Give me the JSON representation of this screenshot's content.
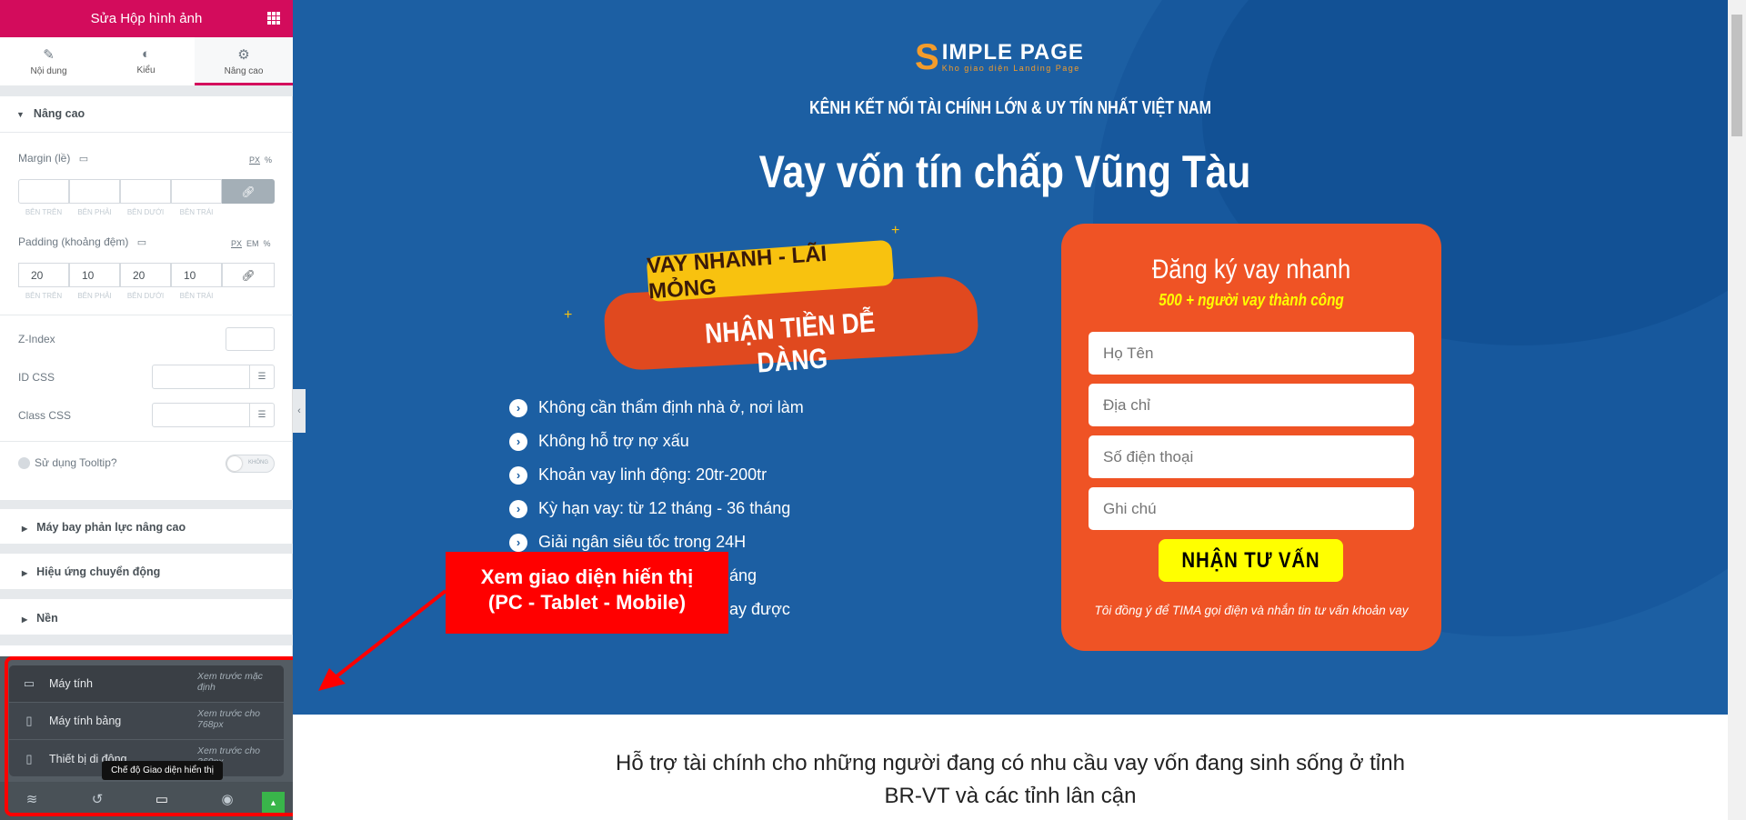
{
  "sidebar": {
    "title": "Sửa Hộp hình ảnh",
    "tabs": [
      {
        "label": "Nội dung",
        "icon": "pencil-icon"
      },
      {
        "label": "Kiểu",
        "icon": "contrast-icon"
      },
      {
        "label": "Nâng cao",
        "icon": "gear-icon",
        "active": true
      }
    ],
    "section_title": "Nâng cao",
    "margin": {
      "label": "Margin (lề)",
      "units": [
        "PX",
        "%"
      ],
      "values": [
        "",
        "",
        "",
        ""
      ]
    },
    "padding": {
      "label": "Padding (khoảng đệm)",
      "units": [
        "PX",
        "EM",
        "%"
      ],
      "values": [
        "20",
        "10",
        "20",
        "10"
      ]
    },
    "side_labels": [
      "BÊN TRÊN",
      "BÊN PHẢI",
      "BÊN DƯỚI",
      "BÊN TRÁI"
    ],
    "z_index_label": "Z-Index",
    "id_css_label": "ID CSS",
    "class_css_label": "Class CSS",
    "tooltip_label": "Sử dụng Tooltip?",
    "tooltip_toggle": "KHÔNG",
    "collapsed_sections": [
      "Máy bay phản lực nâng cao",
      "Hiệu ứng chuyển động",
      "Nền"
    ],
    "device_menu": [
      {
        "label": "Máy tính",
        "hint": "Xem trước mặc định"
      },
      {
        "label": "Máy tính bảng",
        "hint": "Xem trước cho 768px"
      },
      {
        "label": "Thiết bị di động",
        "hint": "Xem trước cho 360px"
      }
    ],
    "tooltip": "Chế độ Giao diện hiển thị"
  },
  "annotation": {
    "line1": "Xem giao diện hiến thị",
    "line2": "(PC - Tablet - Mobile)",
    "color": "#ff0000"
  },
  "page": {
    "logo_main": "IMPLE PAGE",
    "logo_sub": "Kho giao diện Landing Page",
    "tagline": "KÊNH KẾT NỐI TÀI CHÍNH LỚN & UY TÍN NHẤT VIỆT NAM",
    "title": "Vay vốn tín chấp Vũng Tàu",
    "banner_line1": "VAY NHANH - LÃI MỎNG",
    "banner_line2": "NHẬN TIỀN DỄ DÀNG",
    "features": [
      "Không cần thẩm định nhà ở, nơi làm",
      "Không hỗ trợ nợ xấu",
      "Khoản vay linh động: 20tr-200tr",
      "Kỳ hạn vay: từ 12 tháng - 36 tháng",
      "Giải ngân siêu tốc trong 24H",
      "áng",
      "ay được"
    ],
    "form": {
      "title": "Đăng ký vay nhanh",
      "subtitle": "500 + người vay thành công",
      "fields": [
        "Họ Tên",
        "Địa chỉ",
        "Số điện thoại",
        "Ghi chú"
      ],
      "button": "NHẬN TƯ VẤN",
      "disclaimer": "Tôi đồng ý để TIMA gọi điện và nhắn tin tư vấn khoản vay"
    },
    "intro_line1": "Hỗ trợ tài chính cho những người đang có nhu cầu vay vốn đang sinh sống ở tỉnh",
    "intro_line2": "BR-VT và các tỉnh lân cận"
  },
  "colors": {
    "brand": "#d30c5c",
    "hero": "#1c5fa3",
    "form": "#ef5325",
    "button": "#ffff00",
    "logo": "#f39c2b"
  }
}
